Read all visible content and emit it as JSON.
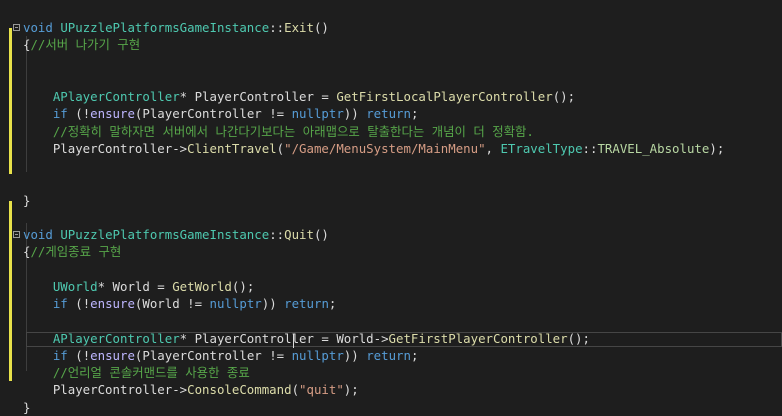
{
  "editor": {
    "lines": [
      {
        "segments": [
          {
            "c": "kw",
            "t": "void"
          },
          {
            "c": "tx",
            "t": " "
          },
          {
            "c": "ty",
            "t": "UPuzzlePlatformsGameInstance"
          },
          {
            "c": "tx",
            "t": "::"
          },
          {
            "c": "fn",
            "t": "Exit"
          },
          {
            "c": "tx",
            "t": "()"
          }
        ]
      },
      {
        "segments": [
          {
            "c": "tx",
            "t": "{"
          },
          {
            "c": "cm",
            "t": "//서버 나가기 구현"
          }
        ]
      },
      {
        "segments": []
      },
      {
        "segments": []
      },
      {
        "segments": [
          {
            "c": "tx",
            "t": "    "
          },
          {
            "c": "ty",
            "t": "APlayerController"
          },
          {
            "c": "tx",
            "t": "* "
          },
          {
            "c": "tx",
            "t": "PlayerController"
          },
          {
            "c": "tx",
            "t": " = "
          },
          {
            "c": "fn",
            "t": "GetFirstLocalPlayerController"
          },
          {
            "c": "tx",
            "t": "();"
          }
        ]
      },
      {
        "segments": [
          {
            "c": "tx",
            "t": "    "
          },
          {
            "c": "kw",
            "t": "if"
          },
          {
            "c": "tx",
            "t": " ("
          },
          {
            "c": "tx",
            "t": "!"
          },
          {
            "c": "mc",
            "t": "ensure"
          },
          {
            "c": "tx",
            "t": "(PlayerController != "
          },
          {
            "c": "kw",
            "t": "nullptr"
          },
          {
            "c": "tx",
            "t": ")) "
          },
          {
            "c": "kw",
            "t": "return"
          },
          {
            "c": "tx",
            "t": ";"
          }
        ]
      },
      {
        "segments": [
          {
            "c": "tx",
            "t": "    "
          },
          {
            "c": "cm",
            "t": "//정확히 말하자면 서버에서 나간다기보다는 아래맵으로 탈출한다는 개념이 더 정확함."
          }
        ]
      },
      {
        "segments": [
          {
            "c": "tx",
            "t": "    "
          },
          {
            "c": "tx",
            "t": "PlayerController->"
          },
          {
            "c": "fn",
            "t": "ClientTravel"
          },
          {
            "c": "tx",
            "t": "("
          },
          {
            "c": "st",
            "t": "\"/Game/MenuSystem/MainMenu\""
          },
          {
            "c": "tx",
            "t": ", "
          },
          {
            "c": "ty",
            "t": "ETravelType"
          },
          {
            "c": "tx",
            "t": "::"
          },
          {
            "c": "en",
            "t": "TRAVEL_Absolute"
          },
          {
            "c": "tx",
            "t": ");"
          }
        ]
      },
      {
        "segments": []
      },
      {
        "segments": []
      },
      {
        "segments": [
          {
            "c": "tx",
            "t": "}"
          }
        ]
      },
      {
        "segments": []
      },
      {
        "segments": [
          {
            "c": "kw",
            "t": "void"
          },
          {
            "c": "tx",
            "t": " "
          },
          {
            "c": "ty",
            "t": "UPuzzlePlatformsGameInstance"
          },
          {
            "c": "tx",
            "t": "::"
          },
          {
            "c": "fn",
            "t": "Quit"
          },
          {
            "c": "tx",
            "t": "()"
          }
        ]
      },
      {
        "segments": [
          {
            "c": "tx",
            "t": "{"
          },
          {
            "c": "cm",
            "t": "//게임종료 구현"
          }
        ]
      },
      {
        "segments": []
      },
      {
        "segments": [
          {
            "c": "tx",
            "t": "    "
          },
          {
            "c": "ty",
            "t": "UWorld"
          },
          {
            "c": "tx",
            "t": "* World = "
          },
          {
            "c": "fn",
            "t": "GetWorld"
          },
          {
            "c": "tx",
            "t": "();"
          }
        ]
      },
      {
        "segments": [
          {
            "c": "tx",
            "t": "    "
          },
          {
            "c": "kw",
            "t": "if"
          },
          {
            "c": "tx",
            "t": " ("
          },
          {
            "c": "tx",
            "t": "!"
          },
          {
            "c": "mc",
            "t": "ensure"
          },
          {
            "c": "tx",
            "t": "(World != "
          },
          {
            "c": "kw",
            "t": "nullptr"
          },
          {
            "c": "tx",
            "t": ")) "
          },
          {
            "c": "kw",
            "t": "return"
          },
          {
            "c": "tx",
            "t": ";"
          }
        ]
      },
      {
        "segments": []
      },
      {
        "segments": [
          {
            "c": "tx",
            "t": "    "
          },
          {
            "c": "ty",
            "t": "APlayerController"
          },
          {
            "c": "tx",
            "t": "* PlayerController = World->"
          },
          {
            "c": "fn",
            "t": "GetFirstPlayerController"
          },
          {
            "c": "tx",
            "t": "();"
          }
        ]
      },
      {
        "segments": [
          {
            "c": "tx",
            "t": "    "
          },
          {
            "c": "kw",
            "t": "if"
          },
          {
            "c": "tx",
            "t": " ("
          },
          {
            "c": "tx",
            "t": "!"
          },
          {
            "c": "mc",
            "t": "ensure"
          },
          {
            "c": "tx",
            "t": "(PlayerController != "
          },
          {
            "c": "kw",
            "t": "nullptr"
          },
          {
            "c": "tx",
            "t": ")) "
          },
          {
            "c": "kw",
            "t": "return"
          },
          {
            "c": "tx",
            "t": ";"
          }
        ]
      },
      {
        "segments": [
          {
            "c": "tx",
            "t": "    "
          },
          {
            "c": "cm",
            "t": "//언리얼 콘솔커맨드를 사용한 종료"
          }
        ]
      },
      {
        "segments": [
          {
            "c": "tx",
            "t": "    "
          },
          {
            "c": "tx",
            "t": "PlayerController->"
          },
          {
            "c": "fn",
            "t": "ConsoleCommand"
          },
          {
            "c": "tx",
            "t": "("
          },
          {
            "c": "st",
            "t": "\"quit\""
          },
          {
            "c": "tx",
            "t": ");"
          }
        ]
      },
      {
        "segments": [
          {
            "c": "tx",
            "t": "}"
          }
        ]
      }
    ]
  }
}
